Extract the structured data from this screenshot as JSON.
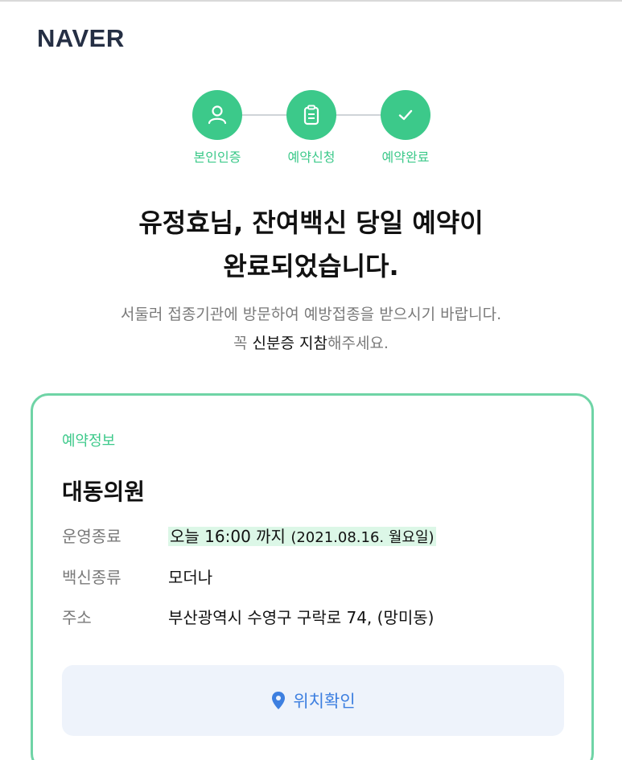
{
  "brand": {
    "logo": "NAVER"
  },
  "steps": [
    {
      "label": "본인인증",
      "icon": "person-icon"
    },
    {
      "label": "예약신청",
      "icon": "clipboard-icon"
    },
    {
      "label": "예약완료",
      "icon": "check-icon"
    }
  ],
  "headline": {
    "line1": "유정효님, 잔여백신 당일 예약이",
    "line2": "완료되었습니다."
  },
  "subtext": {
    "line1": "서둘러 접종기관에 방문하여 예방접종을 받으시기 바랍니다.",
    "line2_prefix": "꼭 ",
    "line2_strong": "신분증 지참",
    "line2_suffix": "해주세요."
  },
  "reservation": {
    "section_title": "예약정보",
    "clinic_name": "대동의원",
    "hours_label": "운영종료",
    "hours_value": "오늘 16:00 까지",
    "hours_date": "(2021.08.16. 월요일)",
    "vaccine_label": "백신종류",
    "vaccine_value": "모더나",
    "address_label": "주소",
    "address_value": "부산광역시 수영구 구락로 74, (망미동)",
    "location_button": "위치확인"
  },
  "colors": {
    "accent": "#3cc98a",
    "link": "#3d7fe0",
    "highlight": "#dcf7e7",
    "brand": "#252f44"
  }
}
